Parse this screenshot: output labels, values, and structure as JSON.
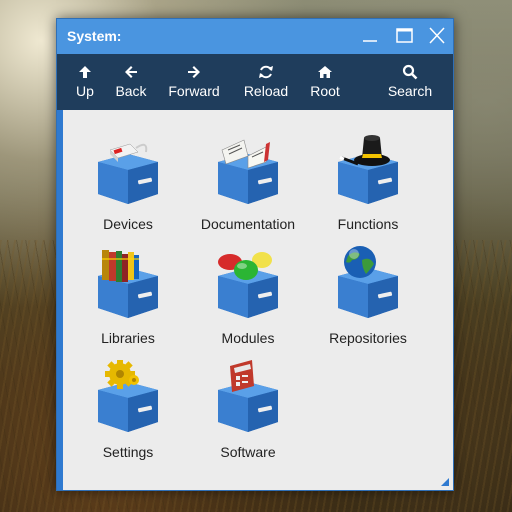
{
  "window": {
    "title": "System:",
    "minimize_icon": "minimize-icon",
    "maximize_icon": "maximize-icon",
    "close_icon": "close-icon"
  },
  "toolbar": {
    "buttons": [
      {
        "label": "Up",
        "icon": "arrow-up-icon"
      },
      {
        "label": "Back",
        "icon": "arrow-left-icon"
      },
      {
        "label": "Forward",
        "icon": "arrow-right-icon"
      },
      {
        "label": "Reload",
        "icon": "reload-icon"
      },
      {
        "label": "Root",
        "icon": "home-icon"
      },
      {
        "label": "Search",
        "icon": "search-icon"
      }
    ]
  },
  "items": [
    {
      "label": "Devices",
      "icon": "devices-drawer-icon"
    },
    {
      "label": "Documentation",
      "icon": "documentation-drawer-icon"
    },
    {
      "label": "Functions",
      "icon": "functions-drawer-icon"
    },
    {
      "label": "Libraries",
      "icon": "libraries-drawer-icon"
    },
    {
      "label": "Modules",
      "icon": "modules-drawer-icon"
    },
    {
      "label": "Repositories",
      "icon": "repositories-drawer-icon"
    },
    {
      "label": "Settings",
      "icon": "settings-drawer-icon"
    },
    {
      "label": "Software",
      "icon": "software-drawer-icon"
    }
  ],
  "colors": {
    "titlebar": "#4a95e0",
    "toolbar": "#1f3d5c",
    "content": "#ececec",
    "drawer": "#3a7fd0"
  }
}
